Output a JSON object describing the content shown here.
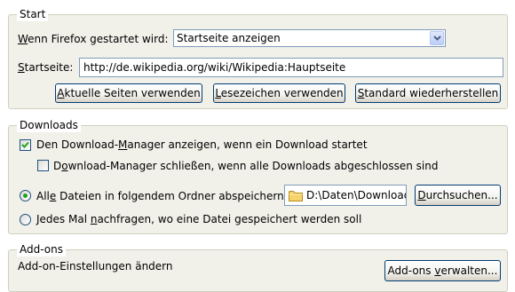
{
  "start": {
    "legend": "Start",
    "startup_label_u": "W",
    "startup_label_rest": "enn Firefox gestartet wird:",
    "startup_value": "Startseite anzeigen",
    "homepage_label_u": "S",
    "homepage_label_rest": "tartseite:",
    "homepage_value": "http://de.wikipedia.org/wiki/Wikipedia:Hauptseite",
    "btn_current_u": "A",
    "btn_current_rest": "ktuelle Seiten verwenden",
    "btn_bookmark_u": "L",
    "btn_bookmark_rest": "esezeichen verwenden",
    "btn_restore_u": "S",
    "btn_restore_rest": "tandard wiederherstellen"
  },
  "downloads": {
    "legend": "Downloads",
    "show_dm_a": "Den Download-",
    "show_dm_u": "M",
    "show_dm_b": "anager anzeigen, wenn ein Download startet",
    "show_dm_checked": true,
    "close_dm_a": "D",
    "close_dm_u": "o",
    "close_dm_b": "wnload-Manager schließen, wenn alle Downloads abgeschlossen sind",
    "close_dm_checked": false,
    "save_all_a": "All",
    "save_all_u": "e",
    "save_all_b": " Dateien in folgendem Ordner abspeichern:",
    "save_all_selected": true,
    "folder_path": "D:\\Daten\\Downloads",
    "browse_u": "D",
    "browse_rest": "urchsuchen...",
    "ask_a": "Jedes Mal ",
    "ask_u": "n",
    "ask_b": "achfragen, wo eine Datei gespeichert werden soll",
    "ask_selected": false
  },
  "addons": {
    "legend": "Add-ons",
    "description": "Add-on-Einstellungen ändern",
    "manage_a": "Add-ons ",
    "manage_u": "v",
    "manage_b": "erwalten..."
  },
  "colors": {
    "group_bg": "#f1f0e9",
    "group_border": "#d0d0bf",
    "button_border": "#003c74",
    "check_mark": "#21a121",
    "input_border": "#7f9db9"
  }
}
